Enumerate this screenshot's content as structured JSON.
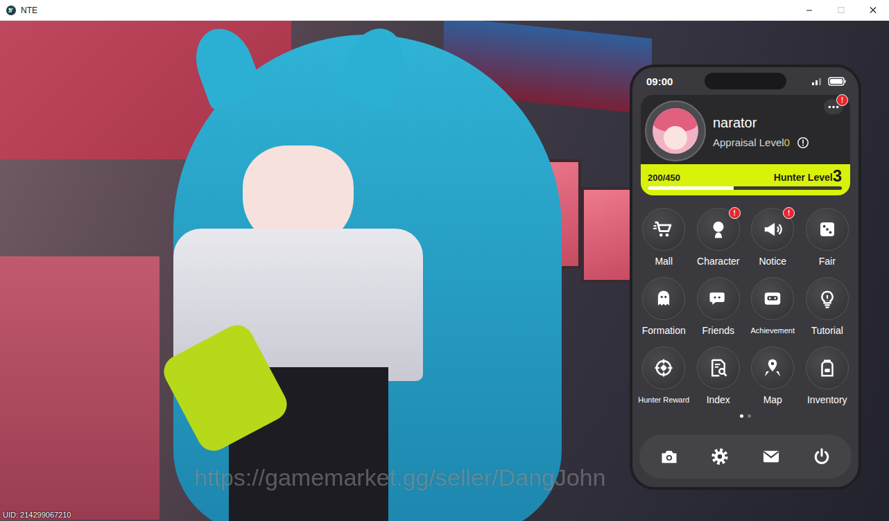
{
  "window": {
    "title": "NTE",
    "controls": [
      {
        "disabled": false
      },
      {
        "disabled": true
      },
      {
        "disabled": false
      }
    ]
  },
  "game": {
    "uid": "UID: 214299067210",
    "watermark": "https://gamemarket.gg/seller/DangJohn"
  },
  "phone": {
    "time": "09:00",
    "alert_mark": "!",
    "profile": {
      "name": "narator",
      "appraisal_label": "Appraisal Level",
      "appraisal_level": "0",
      "menu_alert": true,
      "exp": "200/450",
      "exp_level": 0.444,
      "hunter_label": "Hunter Level",
      "hunter_level": "3"
    },
    "apps": [
      {
        "label": "Mall",
        "alert": false
      },
      {
        "label": "Character",
        "alert": true
      },
      {
        "label": "Notice",
        "alert": true
      },
      {
        "label": "Fair",
        "alert": false
      },
      {
        "label": "Formation",
        "alert": false
      },
      {
        "label": "Friends",
        "alert": false
      },
      {
        "label": "Achievement",
        "alert": false
      },
      {
        "label": "Tutorial",
        "alert": false
      },
      {
        "label": "Hunter Reward",
        "alert": false
      },
      {
        "label": "Index",
        "alert": false
      },
      {
        "label": "Map",
        "alert": false
      },
      {
        "label": "Inventory",
        "alert": false
      }
    ],
    "pages": [
      {
        "selected": true
      },
      {
        "selected": false
      }
    ]
  }
}
